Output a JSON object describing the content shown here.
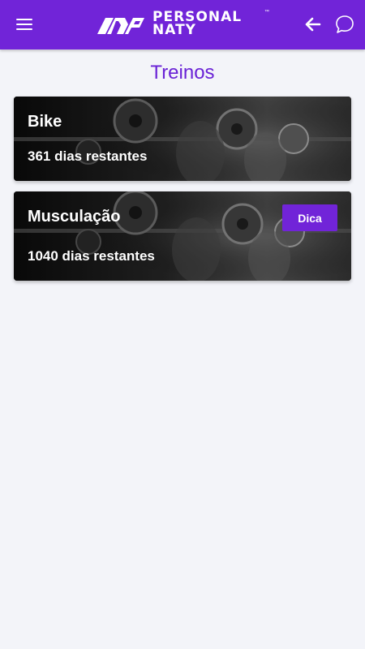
{
  "header": {
    "logo_line1": "PERSONAL",
    "logo_line2": "NATY",
    "logo_tm": "™",
    "menu_icon": "hamburger-menu-icon",
    "back_icon": "arrow-left-icon",
    "chat_icon": "chat-bubble-icon",
    "background_color": "#7124d8"
  },
  "page": {
    "title": "Treinos",
    "title_color": "#6a22d6",
    "background_color": "#f3f4f9"
  },
  "workouts": [
    {
      "name": "Bike",
      "remaining": "361 dias restantes"
    },
    {
      "name": "Musculação",
      "remaining": "1040 dias restantes",
      "tip_label": "Dica"
    }
  ]
}
